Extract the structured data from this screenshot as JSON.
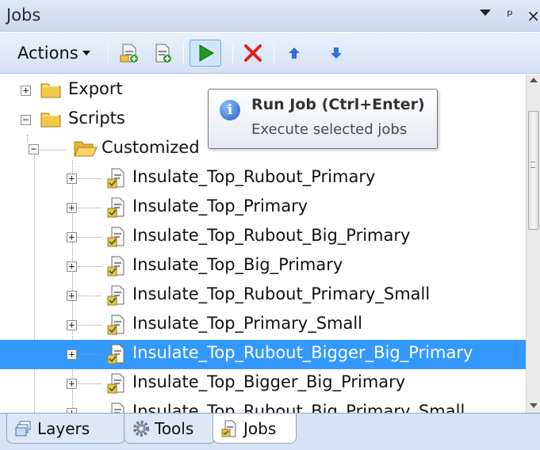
{
  "panel": {
    "title": "Jobs",
    "pin_glyph": "ᵖ",
    "close_glyph": "×"
  },
  "toolbar": {
    "actions_label": "Actions",
    "icons": [
      "add-job-icon",
      "new-job-icon",
      "run-icon",
      "delete-icon",
      "move-up-icon",
      "move-down-icon"
    ]
  },
  "tooltip": {
    "title": "Run Job (Ctrl+Enter)",
    "description": "Execute selected jobs"
  },
  "tree": {
    "export_label": "Export",
    "scripts_label": "Scripts",
    "customized_label": "Customized",
    "jobs": [
      "Insulate_Top_Rubout_Primary",
      "Insulate_Top_Primary",
      "Insulate_Top_Rubout_Big_Primary",
      "Insulate_Top_Big_Primary",
      "Insulate_Top_Rubout_Primary_Small",
      "Insulate_Top_Primary_Small",
      "Insulate_Top_Rubout_Bigger_Big_Primary",
      "Insulate_Top_Bigger_Big_Primary",
      "Insulate_Top_Rubout_Big_Primary_Small"
    ],
    "selected_index": 6
  },
  "tabs": [
    {
      "label": "Layers",
      "icon": "layers-icon"
    },
    {
      "label": "Tools",
      "icon": "gear-icon"
    },
    {
      "label": "Jobs",
      "icon": "jobs-icon",
      "active": true
    }
  ],
  "colors": {
    "selection": "#3399ff",
    "run_green": "#1e9b1e",
    "delete_red": "#e02020",
    "arrow_blue": "#2f6fd6"
  }
}
